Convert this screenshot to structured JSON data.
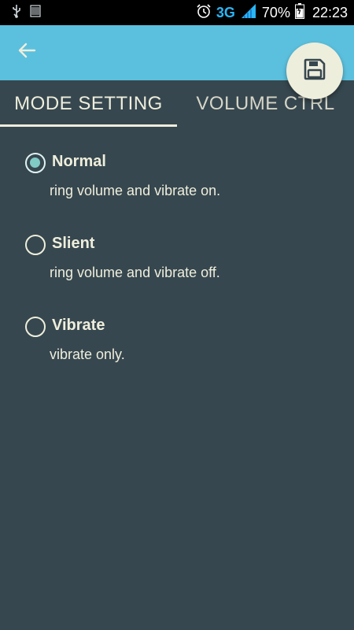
{
  "status_bar": {
    "icons": [
      "usb-icon",
      "sim-card-icon",
      "alarm-clock-icon",
      "signal-icon",
      "battery-icon"
    ],
    "network": "3G",
    "battery": "70%",
    "time": "22:23"
  },
  "app_bar": {
    "back_icon": "arrow-left-icon",
    "save_icon": "floppy-disk-icon",
    "color": "#5bc0de"
  },
  "tabs": [
    {
      "label": "MODE SETTING",
      "selected": true
    },
    {
      "label": "VOLUME CTRL",
      "selected": false
    }
  ],
  "modes": [
    {
      "title": "Normal",
      "description": "ring volume and vibrate on.",
      "checked": true
    },
    {
      "title": "Slient",
      "description": "ring volume and vibrate off.",
      "checked": false
    },
    {
      "title": "Vibrate",
      "description": "vibrate only.",
      "checked": false
    }
  ],
  "colors": {
    "background": "#37474f",
    "accent": "#80cbc4",
    "text": "#eeeedc",
    "fab": "#eeeedc"
  }
}
